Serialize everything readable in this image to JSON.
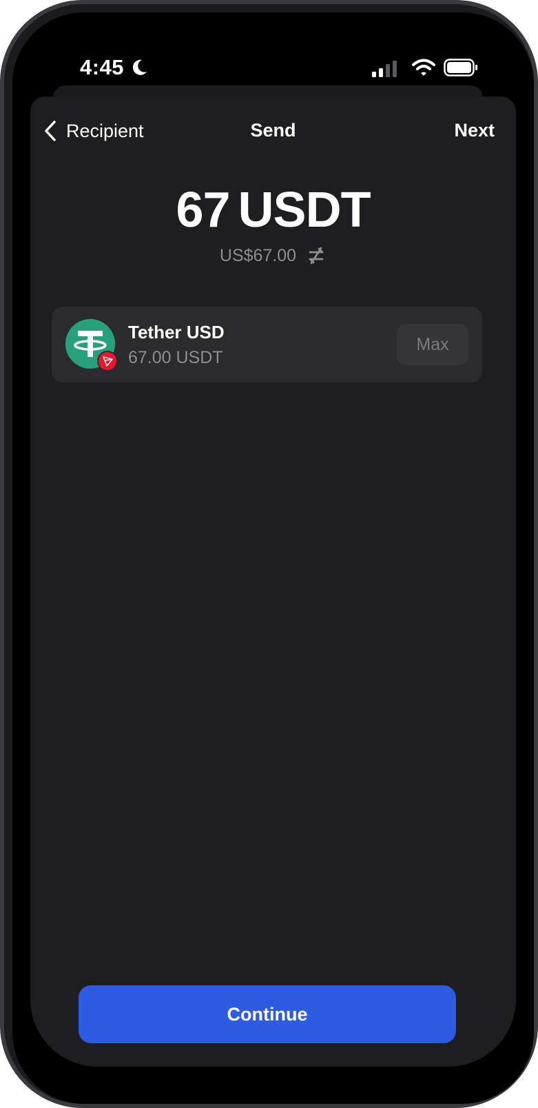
{
  "status_bar": {
    "time": "4:45",
    "icons": [
      "moon-icon",
      "cellular-signal-icon",
      "wifi-icon",
      "battery-icon"
    ]
  },
  "nav": {
    "back_label": "Recipient",
    "title": "Send",
    "next_label": "Next"
  },
  "amount": {
    "value": "67",
    "unit": "USDT",
    "fiat": "US$67.00"
  },
  "asset": {
    "name": "Tether USD",
    "balance": "67.00 USDT",
    "max_label": "Max",
    "logo_icon": "tether-logo-icon",
    "chain_icon": "tron-badge-icon"
  },
  "actions": {
    "continue_label": "Continue"
  },
  "colors": {
    "accent": "#2d5be3",
    "tether": "#26a17b",
    "tron": "#e6192c"
  }
}
